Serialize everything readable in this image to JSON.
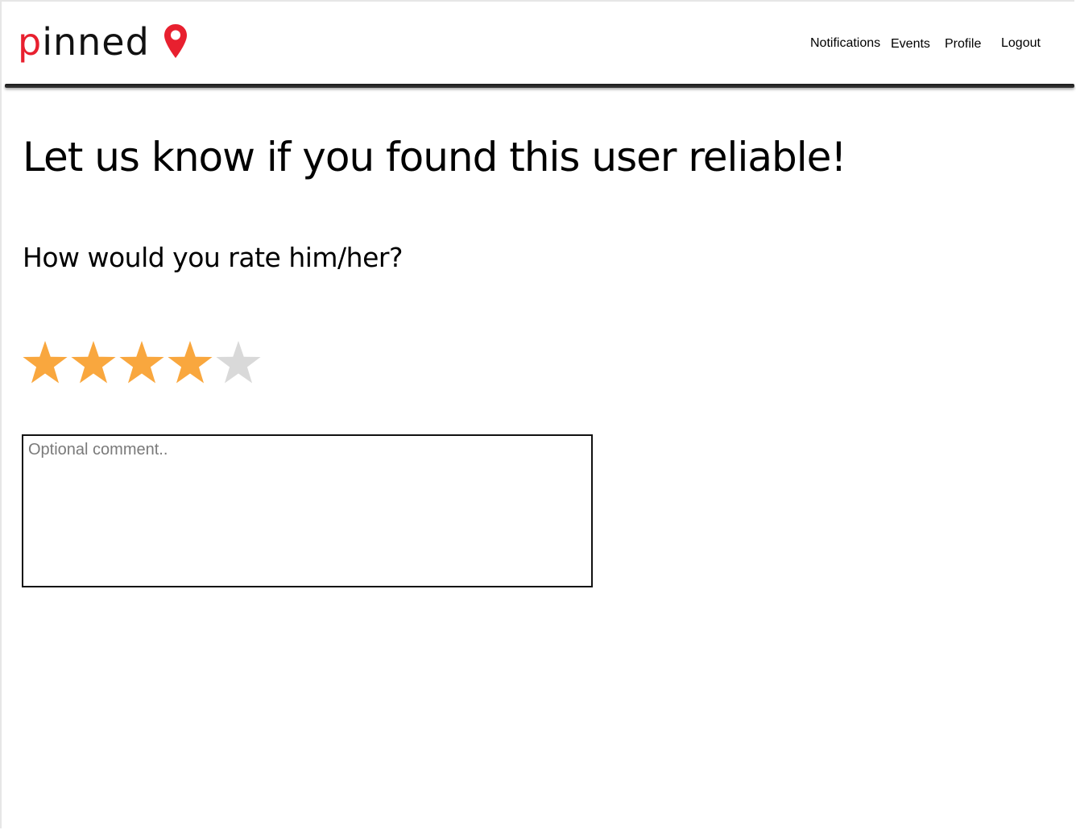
{
  "brand": {
    "logo_text": "pinned",
    "logo_first_letter": "p",
    "logo_rest": "inned",
    "logo_icon": "map-pin-icon",
    "accent_color": "#e8202f"
  },
  "nav": {
    "items": [
      {
        "label": "Notifications"
      },
      {
        "label": "Events"
      },
      {
        "label": "Profile"
      },
      {
        "label": "Logout"
      }
    ]
  },
  "main": {
    "title": "Let us know if you found this user reliable!",
    "subtitle": "How would you rate him/her?",
    "rating": {
      "value": 4,
      "max": 5,
      "filled_color": "#f9a73e",
      "empty_color": "#d9d9d9",
      "icon": "star-icon"
    },
    "comment": {
      "placeholder": "Optional comment..",
      "value": ""
    }
  }
}
